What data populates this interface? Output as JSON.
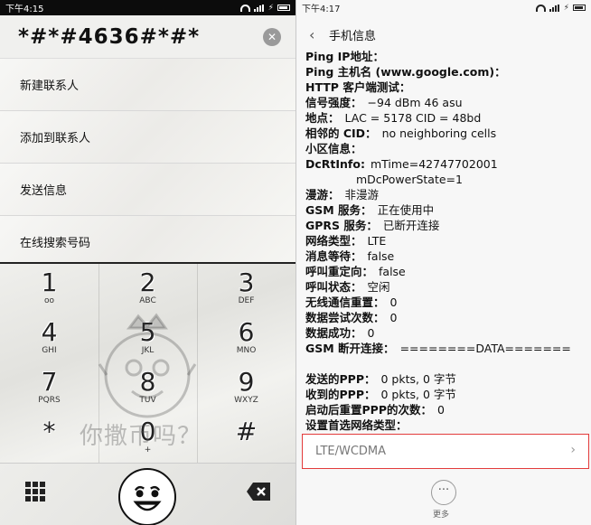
{
  "left": {
    "status": {
      "time": "下午4:15"
    },
    "dialer": {
      "number": "*#*#4636#*#*",
      "clear_icon": "clear-circle-icon"
    },
    "menu": [
      {
        "label": "新建联系人"
      },
      {
        "label": "添加到联系人"
      },
      {
        "label": "发送信息"
      },
      {
        "label": "在线搜索号码"
      }
    ],
    "keys": [
      {
        "digit": "1",
        "letters": "oo"
      },
      {
        "digit": "2",
        "letters": "ABC"
      },
      {
        "digit": "3",
        "letters": "DEF"
      },
      {
        "digit": "4",
        "letters": "GHI"
      },
      {
        "digit": "5",
        "letters": "JKL"
      },
      {
        "digit": "6",
        "letters": "MNO"
      },
      {
        "digit": "7",
        "letters": "PQRS"
      },
      {
        "digit": "8",
        "letters": "TUV"
      },
      {
        "digit": "9",
        "letters": "WXYZ"
      },
      {
        "digit": "*",
        "letters": ""
      },
      {
        "digit": "0",
        "letters": "+"
      },
      {
        "digit": "#",
        "letters": ""
      }
    ],
    "watermark": "你撒币吗？"
  },
  "right": {
    "status": {
      "time": "下午4:17"
    },
    "title": "手机信息",
    "rows": [
      {
        "label": "Ping IP地址：",
        "value": ""
      },
      {
        "label": "Ping 主机名 (www.google.com)：",
        "value": ""
      },
      {
        "label": "HTTP 客户端测试：",
        "value": ""
      },
      {
        "label": "信号强度：",
        "value": "−94 dBm   46 asu"
      },
      {
        "label": "地点：",
        "value": "LAC = 5178   CID = 48bd"
      },
      {
        "label": "相邻的 CID：",
        "value": "no neighboring cells"
      },
      {
        "label": "小区信息：",
        "value": ""
      },
      {
        "label": "DcRtInfo:",
        "value": "mTime=42747702001"
      },
      {
        "label": "",
        "value": "mDcPowerState=1"
      },
      {
        "label": "漫游：",
        "value": "非漫游"
      },
      {
        "label": "GSM 服务：",
        "value": "正在使用中"
      },
      {
        "label": "GPRS 服务：",
        "value": "已断开连接"
      },
      {
        "label": "网络类型：",
        "value": "LTE"
      },
      {
        "label": "消息等待：",
        "value": "false"
      },
      {
        "label": "呼叫重定向：",
        "value": "false"
      },
      {
        "label": "呼叫状态：",
        "value": "空闲"
      },
      {
        "label": "无线通信重置：",
        "value": "0"
      },
      {
        "label": "数据尝试次数：",
        "value": "0"
      },
      {
        "label": "数据成功：",
        "value": "0"
      },
      {
        "label": "GSM 断开连接：",
        "value": "========DATA======="
      },
      {
        "label": "",
        "value": ""
      },
      {
        "label": "发送的PPP：",
        "value": "0 pkts, 0 字节"
      },
      {
        "label": "收到的PPP：",
        "value": "0 pkts, 0 字节"
      },
      {
        "label": "启动后重置PPP的次数：",
        "value": "0"
      },
      {
        "label": "设置首选网络类型：",
        "value": ""
      }
    ],
    "preferred_network": "LTE/WCDMA",
    "more_label": "更多"
  }
}
